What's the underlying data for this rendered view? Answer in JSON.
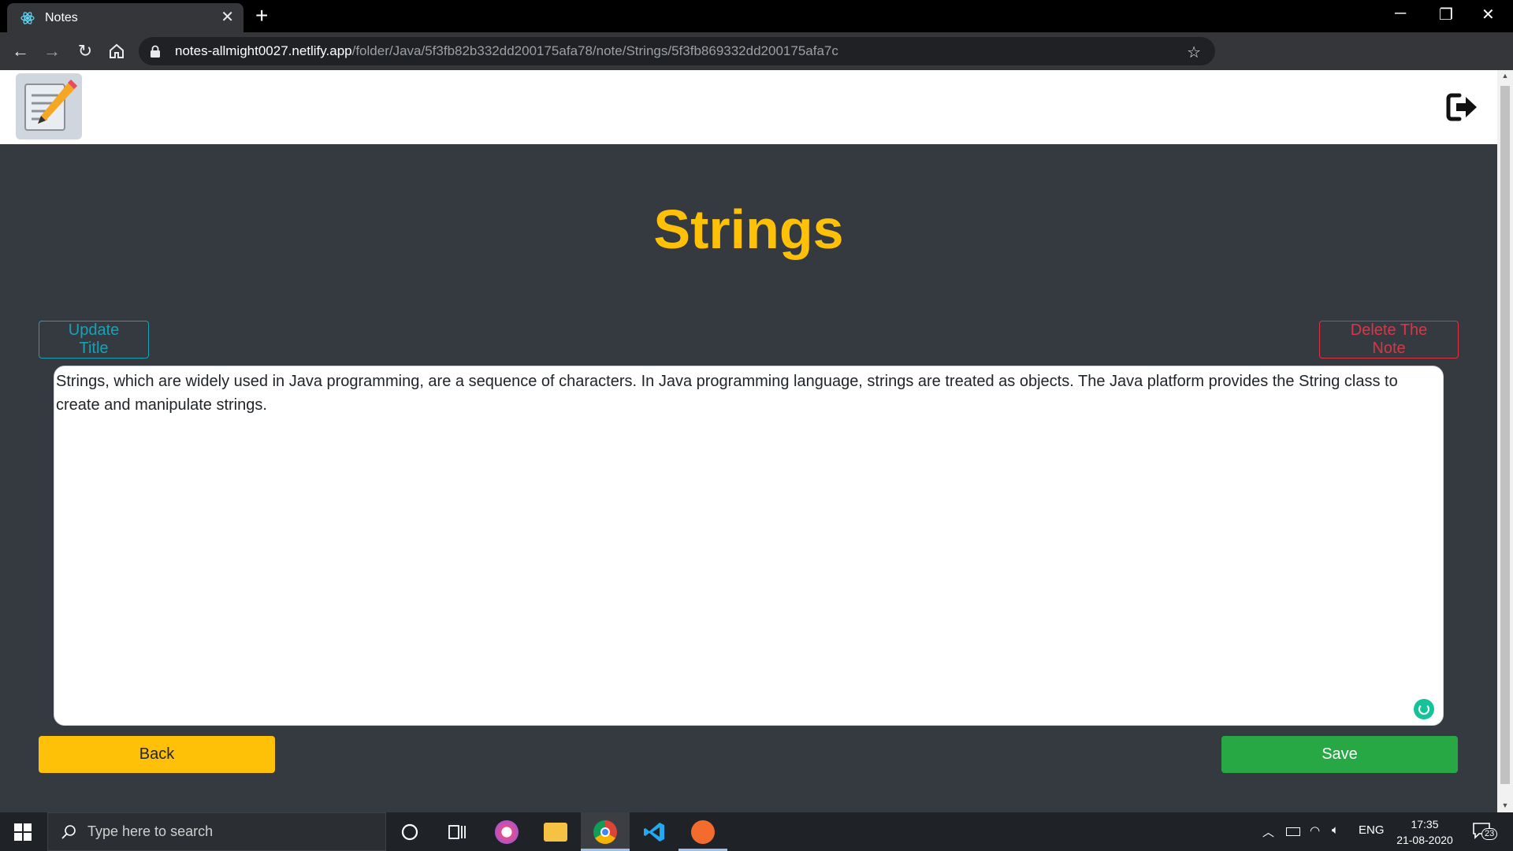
{
  "browser": {
    "tab_title": "Notes",
    "url_host": "notes-allmight0027.netlify.app",
    "url_path": "/folder/Java/5f3fb82b332dd200175afa78/note/Strings/5f3fb869332dd200175afa7c"
  },
  "app": {
    "note_title": "Strings",
    "update_title_label": "Update Title",
    "delete_note_label": "Delete The Note",
    "note_body": "Strings, which are widely used in Java programming, are a sequence of characters. In Java programming language, strings are treated as objects. The Java platform provides the String class to create and manipulate strings.",
    "back_label": "Back",
    "save_label": "Save"
  },
  "taskbar": {
    "search_placeholder": "Type here to search",
    "language": "ENG",
    "time": "17:35",
    "date": "21-08-2020",
    "notification_count": "23"
  },
  "colors": {
    "page_bg": "#343a40",
    "title": "#ffc107",
    "info": "#17a2b8",
    "danger": "#dc3545",
    "warning": "#ffc107",
    "success": "#28a745"
  }
}
